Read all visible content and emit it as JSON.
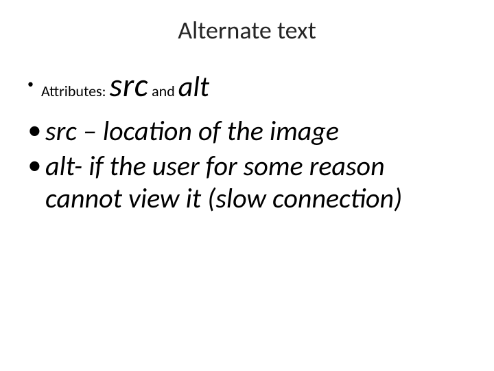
{
  "slide": {
    "title": "Alternate text",
    "bullet1": {
      "label": "Attributes: ",
      "term1": "src",
      "connector": " and ",
      "term2": "alt"
    },
    "bullet2": "src – location of the image",
    "bullet3": "alt- if the user for some reason cannot view it (slow connection)"
  }
}
